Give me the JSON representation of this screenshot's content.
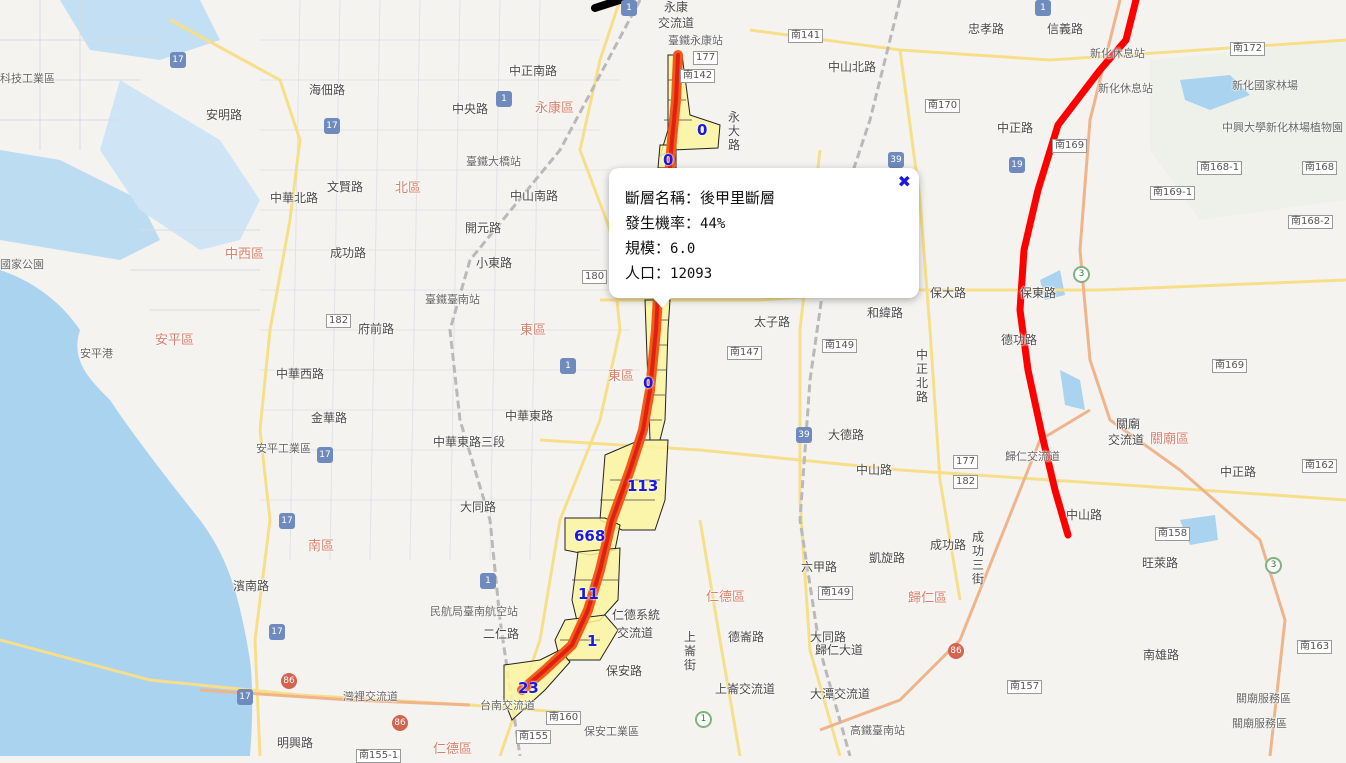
{
  "popup": {
    "name_label": "斷層名稱：",
    "name_value": "後甲里斷層",
    "prob_label": "發生機率：",
    "prob_value": "44%",
    "scale_label": "規模：",
    "scale_value": "6.0",
    "pop_label": "人口：",
    "pop_value": "12093",
    "close_icon": "✖"
  },
  "population_labels": [
    "0",
    "0",
    "0",
    "113",
    "668",
    "11",
    "1",
    "23"
  ],
  "colors": {
    "fault_red": "#ff0000",
    "fault_orange": "#f25a1c",
    "zone_fill": "#fbf5a0",
    "pop_text": "#1a1adf"
  },
  "districts": [
    "永康區",
    "北區",
    "中西區",
    "安平區",
    "東區",
    "東區",
    "南區",
    "仁德區",
    "歸仁區",
    "關廟區",
    "仁德區"
  ],
  "roads": [
    "中正南路",
    "中央路",
    "中山北路",
    "忠孝路",
    "信義路",
    "海佃路",
    "安明路",
    "文賢路",
    "中華北路",
    "開元路",
    "中山南路",
    "小東路",
    "成功路",
    "府前路",
    "中華西路",
    "金華路",
    "中華東路",
    "中華東路三段",
    "大同路",
    "濱南路",
    "二仁路",
    "明興路",
    "太子路",
    "和緯路",
    "保大路",
    "保東路",
    "中正北路",
    "大德路",
    "德功路",
    "中山路",
    "中正路",
    "六甲路",
    "凱旋路",
    "成功路",
    "成功三街",
    "中山路",
    "南雄路",
    "旺萊路",
    "永大路",
    "保安路",
    "大同路",
    "上崙街",
    "德崙路",
    "歸仁大道",
    "上崙交流道",
    "大潭交流道",
    "中正路"
  ],
  "places": [
    "永康",
    "交流道",
    "臺鐵永康站",
    "新化休息站",
    "新化休息站",
    "新化國家林場",
    "中興大學新化林場植物園",
    "臺鐵大橋站",
    "臺鐵臺南站",
    "安平港",
    "安平工業區",
    "民航局臺南航空站",
    "仁德系統",
    "交流道",
    "灣裡交流道",
    "台南交流道",
    "保安工業區",
    "高鐵臺南站",
    "關廟",
    "交流道",
    "歸仁交流道",
    "關廟服務區",
    "關廟服務區",
    "科技工業區",
    "國家公園"
  ],
  "route_shields": [
    "南141",
    "南172",
    "177",
    "南142",
    "南170",
    "南169",
    "南168-1",
    "南168",
    "南169-1",
    "南168-2",
    "180",
    "182",
    "南147",
    "南149",
    "南169",
    "177",
    "182",
    "南162",
    "南158",
    "南149",
    "南157",
    "南163",
    "南160",
    "南155",
    "南155-1"
  ],
  "highway_shields": [
    "1",
    "17",
    "17",
    "1",
    "19",
    "39",
    "3",
    "1",
    "17",
    "17",
    "1",
    "39",
    "86",
    "86",
    "86",
    "17",
    "1",
    "3",
    "1",
    "17"
  ]
}
